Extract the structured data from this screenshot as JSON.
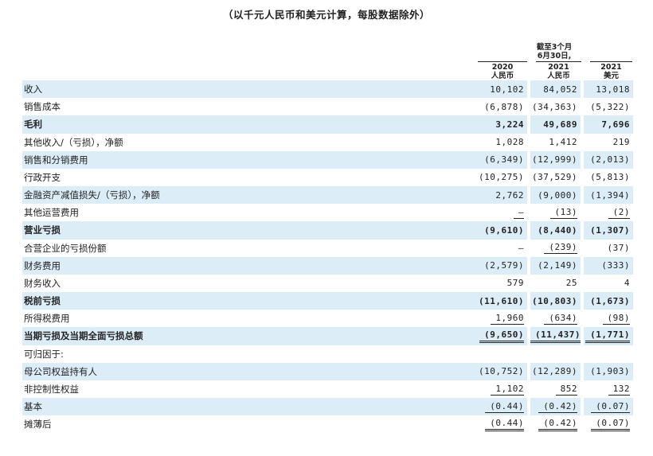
{
  "caption": "（以千元人民币和美元计算，每股数据除外）",
  "period": {
    "line1": "截至3个月",
    "line2": "6月30日,"
  },
  "columns": [
    {
      "year": "2020",
      "currency": "人民币"
    },
    {
      "year": "2021",
      "currency": "人民币"
    },
    {
      "year": "2021",
      "currency": "美元"
    }
  ],
  "rows": [
    {
      "label": "收入",
      "values": [
        "10,102",
        "84,052",
        "13,018"
      ]
    },
    {
      "label": "销售成本",
      "values": [
        "(6,878)",
        "(34,363)",
        "(5,322)"
      ]
    },
    {
      "label": "毛利",
      "values": [
        "3,224",
        "49,689",
        "7,696"
      ]
    },
    {
      "label": "其他收入/（亏损），净额",
      "values": [
        "1,028",
        "1,412",
        "219"
      ]
    },
    {
      "label": "销售和分销费用",
      "values": [
        "(6,349)",
        "(12,999)",
        "(2,013)"
      ]
    },
    {
      "label": "行政开支",
      "values": [
        "(10,275)",
        "(37,529)",
        "(5,813)"
      ]
    },
    {
      "label": "金融资产减值损失/（亏损），净额",
      "values": [
        "2,762",
        "(9,000)",
        "(1,394)"
      ]
    },
    {
      "label": "其他运营费用",
      "values": [
        "—",
        "(13)",
        "(2)"
      ]
    },
    {
      "label": "营业亏损",
      "values": [
        "(9,610)",
        "(8,440)",
        "(1,307)"
      ]
    },
    {
      "label": "合营企业的亏损份额",
      "values": [
        "—",
        "(239)",
        "(37)"
      ]
    },
    {
      "label": "财务费用",
      "values": [
        "(2,579)",
        "(2,149)",
        "(333)"
      ]
    },
    {
      "label": "财务收入",
      "values": [
        "579",
        "25",
        "4"
      ]
    },
    {
      "label": "税前亏损",
      "values": [
        "(11,610)",
        "(10,803)",
        "(1,673)"
      ]
    },
    {
      "label": "所得税费用",
      "values": [
        "1,960",
        "(634)",
        "(98)"
      ]
    },
    {
      "label": "当期亏损及当期全面亏损总额",
      "values": [
        "(9,650)",
        "(11,437)",
        "(1,771)"
      ]
    },
    {
      "label": "可归因于:",
      "values": [
        "",
        "",
        ""
      ]
    },
    {
      "label": "母公司权益持有人",
      "values": [
        "(10,752)",
        "(12,289)",
        "(1,903)"
      ]
    },
    {
      "label": "非控制性权益",
      "values": [
        "1,102",
        "852",
        "132"
      ]
    },
    {
      "label": "基本",
      "values": [
        "(0.44)",
        "(0.42)",
        "(0.07)"
      ]
    },
    {
      "label": "摊薄后",
      "values": [
        "(0.44)",
        "(0.42)",
        "(0.07)"
      ]
    }
  ]
}
